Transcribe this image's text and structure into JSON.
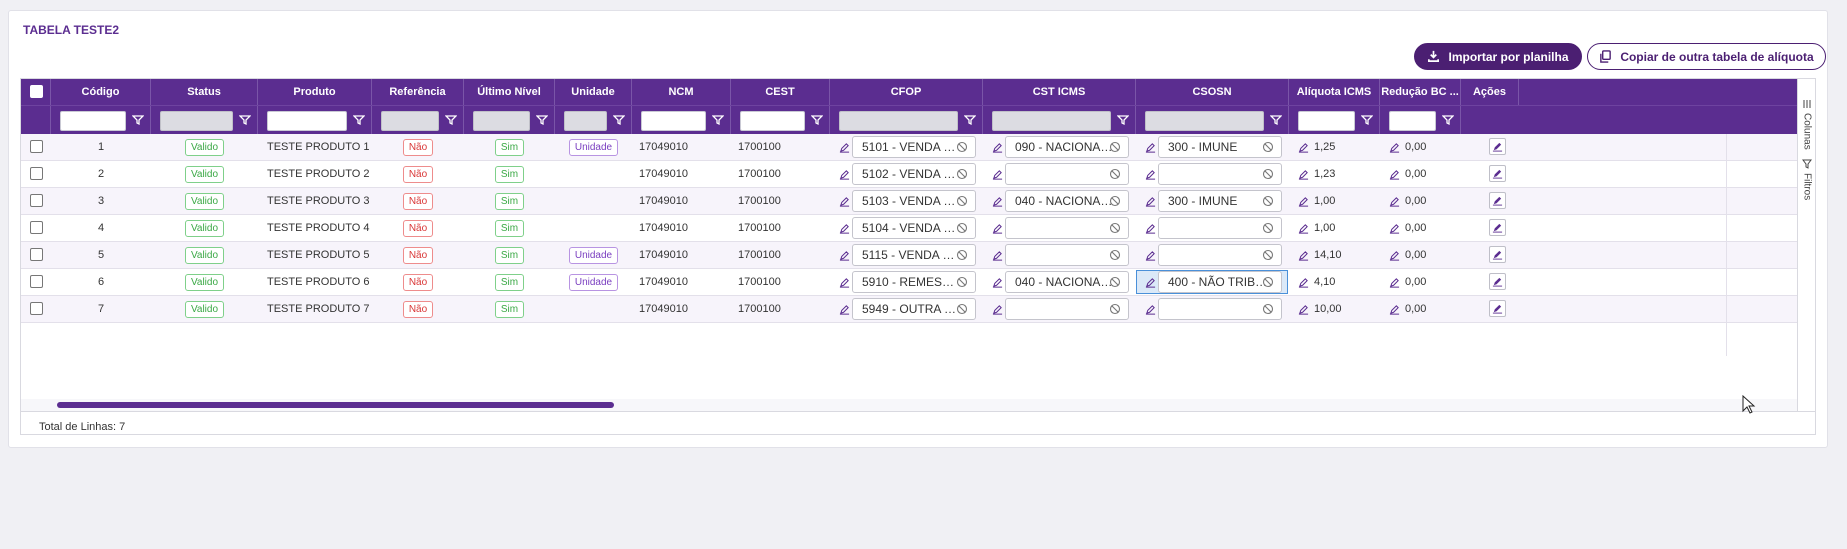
{
  "title": "TABELA TESTE2",
  "buttons": {
    "import": "Importar por planilha",
    "copy": "Copiar de outra tabela de alíquota"
  },
  "columns": [
    {
      "key": "codigo",
      "label": "Código"
    },
    {
      "key": "status",
      "label": "Status"
    },
    {
      "key": "produto",
      "label": "Produto"
    },
    {
      "key": "referencia",
      "label": "Referência"
    },
    {
      "key": "ultimo_nivel",
      "label": "Último Nível"
    },
    {
      "key": "unidade",
      "label": "Unidade"
    },
    {
      "key": "ncm",
      "label": "NCM"
    },
    {
      "key": "cest",
      "label": "CEST"
    },
    {
      "key": "cfop",
      "label": "CFOP"
    },
    {
      "key": "cst_icms",
      "label": "CST ICMS"
    },
    {
      "key": "csosn",
      "label": "CSOSN"
    },
    {
      "key": "aliquota_icms",
      "label": "Alíquota ICMS"
    },
    {
      "key": "reducao_bc",
      "label": "Redução BC ..."
    },
    {
      "key": "acoes",
      "label": "Ações"
    }
  ],
  "rows": [
    {
      "codigo": "1",
      "status": "Valido",
      "produto": "TESTE PRODUTO 1",
      "referencia": "Não",
      "ultimo_nivel": "Sim",
      "unidade": "Unidade",
      "ncm": "17049010",
      "cest": "1700100",
      "cfop": "5101 - VENDA DE ...",
      "cst_icms": "090 - NACIONAL-...",
      "csosn": "300 - IMUNE",
      "aliquota_icms": "1,25",
      "reducao_bc": "0,00"
    },
    {
      "codigo": "2",
      "status": "Valido",
      "produto": "TESTE PRODUTO 2",
      "referencia": "Não",
      "ultimo_nivel": "Sim",
      "unidade": "",
      "ncm": "17049010",
      "cest": "1700100",
      "cfop": "5102 - VENDA DE ...",
      "cst_icms": "",
      "csosn": "",
      "aliquota_icms": "1,23",
      "reducao_bc": "0,00"
    },
    {
      "codigo": "3",
      "status": "Valido",
      "produto": "TESTE PRODUTO 3",
      "referencia": "Não",
      "ultimo_nivel": "Sim",
      "unidade": "",
      "ncm": "17049010",
      "cest": "1700100",
      "cfop": "5103 - VENDA DE ...",
      "cst_icms": "040 - NACIONAL-...",
      "csosn": "300 - IMUNE",
      "aliquota_icms": "1,00",
      "reducao_bc": "0,00"
    },
    {
      "codigo": "4",
      "status": "Valido",
      "produto": "TESTE PRODUTO 4",
      "referencia": "Não",
      "ultimo_nivel": "Sim",
      "unidade": "",
      "ncm": "17049010",
      "cest": "1700100",
      "cfop": "5104 - VENDA DE ...",
      "cst_icms": "",
      "csosn": "",
      "aliquota_icms": "1,00",
      "reducao_bc": "0,00"
    },
    {
      "codigo": "5",
      "status": "Valido",
      "produto": "TESTE PRODUTO 5",
      "referencia": "Não",
      "ultimo_nivel": "Sim",
      "unidade": "Unidade",
      "ncm": "17049010",
      "cest": "1700100",
      "cfop": "5115 - VENDA DE ...",
      "cst_icms": "",
      "csosn": "",
      "aliquota_icms": "14,10",
      "reducao_bc": "0,00"
    },
    {
      "codigo": "6",
      "status": "Valido",
      "produto": "TESTE PRODUTO 6",
      "referencia": "Não",
      "ultimo_nivel": "Sim",
      "unidade": "Unidade",
      "ncm": "17049010",
      "cest": "1700100",
      "cfop": "5910 - REMESSA ...",
      "cst_icms": "040 - NACIONAL-...",
      "csosn": "400 - NÃO TRIBUT...",
      "aliquota_icms": "4,10",
      "reducao_bc": "0,00"
    },
    {
      "codigo": "7",
      "status": "Valido",
      "produto": "TESTE PRODUTO 7",
      "referencia": "Não",
      "ultimo_nivel": "Sim",
      "unidade": "",
      "ncm": "17049010",
      "cest": "1700100",
      "cfop": "5949 - OUTRA SAÍ...",
      "cst_icms": "",
      "csosn": "",
      "aliquota_icms": "10,00",
      "reducao_bc": "0,00"
    }
  ],
  "side_panel": {
    "columns": "Colunas",
    "filters": "Filtros"
  },
  "footer": "Total de Linhas: 7",
  "colors": {
    "primary": "#5b2d90",
    "dark": "#4b1f72",
    "valid": "#3aa845",
    "no": "#d93636",
    "unit": "#7a3fc0"
  },
  "scroll": {
    "thumb_fraction": 0.32
  }
}
